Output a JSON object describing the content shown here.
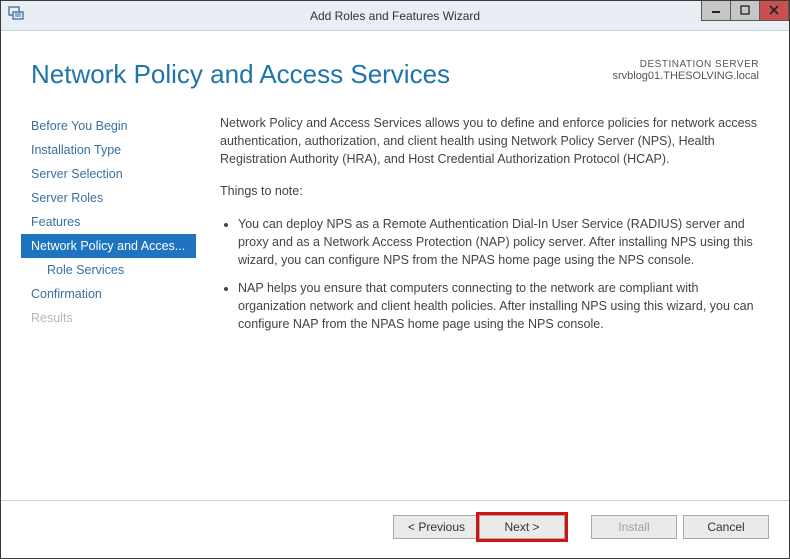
{
  "window": {
    "title": "Add Roles and Features Wizard"
  },
  "header": {
    "page_title": "Network Policy and Access Services",
    "destination_label": "DESTINATION SERVER",
    "destination_server": "srvblog01.THESOLVING.local"
  },
  "steps": {
    "before_you_begin": "Before You Begin",
    "installation_type": "Installation Type",
    "server_selection": "Server Selection",
    "server_roles": "Server Roles",
    "features": "Features",
    "npas": "Network Policy and Acces...",
    "role_services": "Role Services",
    "confirmation": "Confirmation",
    "results": "Results"
  },
  "content": {
    "intro": "Network Policy and Access Services allows you to define and enforce policies for network access authentication, authorization, and client health using Network Policy Server (NPS), Health Registration Authority (HRA), and Host Credential Authorization Protocol (HCAP).",
    "notes_heading": "Things to note:",
    "bullet1": "You can deploy NPS as a Remote Authentication Dial-In User Service (RADIUS) server and proxy and as a Network Access Protection (NAP) policy server. After installing NPS using this wizard, you can configure NPS from the NPAS home page using the NPS console.",
    "bullet2": "NAP helps you ensure that computers connecting to the network are compliant with organization network and client health policies. After installing NPS using this wizard, you can configure NAP from the NPAS home page using the NPS console."
  },
  "buttons": {
    "previous": "< Previous",
    "next": "Next >",
    "install": "Install",
    "cancel": "Cancel"
  }
}
